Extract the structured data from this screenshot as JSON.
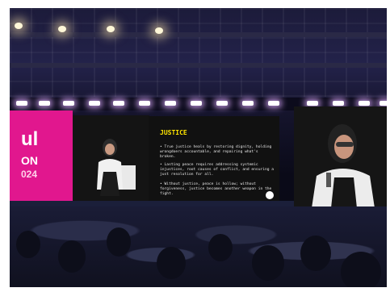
{
  "event_banner": {
    "text_line1": "ul",
    "text_line2": "ON",
    "text_line3": "024"
  },
  "slide": {
    "title": "JUSTICE",
    "bullets": [
      "• True justice heals by restoring dignity, holding wrongdoers accountable, and repairing what's broken.",
      "• Lasting peace requires addressing systemic injustices, root causes of conflict, and ensuring a just resolution for all.",
      "• Without justice, peace is hollow; without forgiveness, justice becomes another weapon in the fight."
    ]
  },
  "colors": {
    "banner_pink": "#e1178e",
    "slide_title": "#ffe500",
    "led_glow": "#d9a8ff"
  }
}
